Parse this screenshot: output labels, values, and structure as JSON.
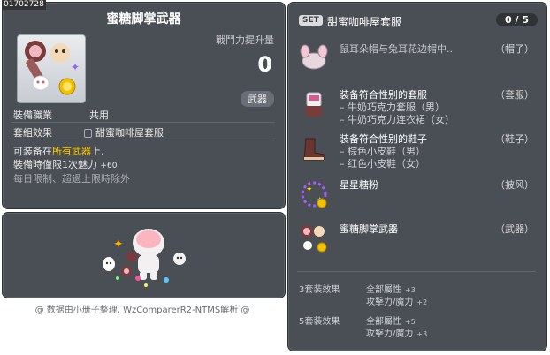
{
  "image_id_label": "01702728",
  "item": {
    "title": "蜜糖脚掌武器",
    "power_label": "戰鬥力提升量",
    "power_value": "0",
    "type_badge": "武器",
    "job_label": "裝備職業",
    "job_value": "共用",
    "set_label": "套組效果",
    "set_value": "甜蜜咖啡屋套服",
    "desc_prefix": "可装备在",
    "desc_highlight": "所有武器",
    "desc_suffix": "上.",
    "limit_text": "裝備時僅限1次魅力",
    "limit_value": "+60",
    "note": "每日限制、超過上限時除外"
  },
  "credit": "@ 数据由小册子整理, WzComparerR2-NTMS解析 @",
  "set_panel": {
    "badge": "SET",
    "name": "甜蜜咖啡屋套服",
    "count": "0 / 5",
    "items": [
      {
        "name": "鼠耳朵帽与兔耳花边帽中..",
        "slot": "（帽子）",
        "subs": []
      },
      {
        "name": "装备符合性别的套服",
        "slot": "（套服）",
        "subs": [
          "– 牛奶巧克力套服（男）",
          "– 牛奶巧克力连衣裙（女）"
        ]
      },
      {
        "name": "装备符合性别的鞋子",
        "slot": "（鞋子）",
        "subs": [
          "– 棕色小皮鞋（男）",
          "– 红色小皮鞋（女）"
        ]
      },
      {
        "name": "星星糖粉",
        "slot": "（披风）",
        "subs": []
      },
      {
        "name": "蜜糖脚掌武器",
        "slot": "（武器）",
        "subs": []
      }
    ],
    "bonuses": [
      {
        "label": "3套装效果",
        "lines": [
          {
            "stat": "全部屬性",
            "val": "+3"
          },
          {
            "stat": "攻擊力/魔力",
            "val": "+2"
          }
        ]
      },
      {
        "label": "5套装效果",
        "lines": [
          {
            "stat": "全部屬性",
            "val": "+5"
          },
          {
            "stat": "攻擊力/魔力",
            "val": "+3"
          }
        ]
      }
    ]
  }
}
